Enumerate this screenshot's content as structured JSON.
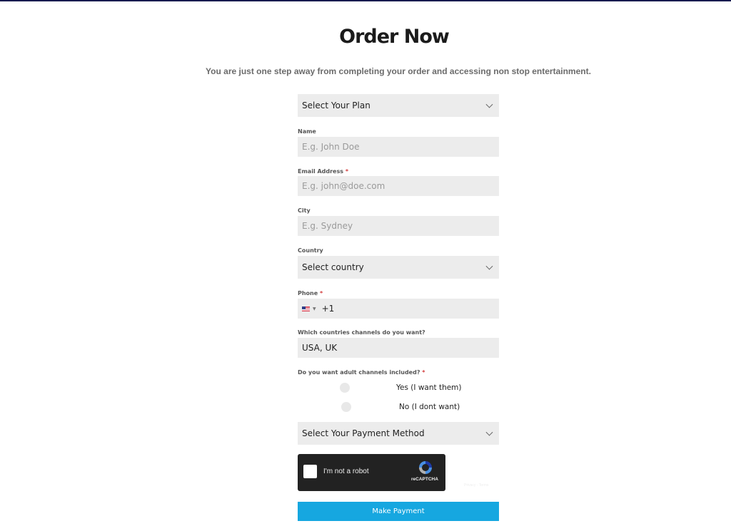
{
  "header": {
    "title": "Order Now",
    "subtitle": "You are just one step away from completing your order and accessing non stop entertainment."
  },
  "form": {
    "plan_select": {
      "value": "Select Your Plan"
    },
    "name": {
      "label": "Name",
      "placeholder": "E.g. John Doe"
    },
    "email": {
      "label": "Email Address",
      "required_mark": "*",
      "placeholder": "E.g. john@doe.com"
    },
    "city": {
      "label": "City",
      "placeholder": "E.g. Sydney"
    },
    "country": {
      "label": "Country",
      "value": "Select country"
    },
    "phone": {
      "label": "Phone",
      "required_mark": "*",
      "flag_icon": "us-flag-icon",
      "dial_code": "+1"
    },
    "channels": {
      "label": "Which countries channels do you want?",
      "value": "USA, UK"
    },
    "adult": {
      "label": "Do you want adult channels included?",
      "required_mark": "*",
      "options": [
        {
          "label": "Yes (I want them)",
          "selected": false
        },
        {
          "label": "No (I dont want)",
          "selected": false
        }
      ]
    },
    "payment_select": {
      "value": "Select Your Payment Method"
    },
    "captcha": {
      "text": "I'm not a robot",
      "brand": "reCAPTCHA",
      "links": "Privacy - Terms"
    },
    "submit_label": "Make Payment"
  },
  "colors": {
    "accent": "#16a7e0",
    "top_border": "#161a4f",
    "field_bg": "#ececec",
    "required": "#d23b3b"
  }
}
